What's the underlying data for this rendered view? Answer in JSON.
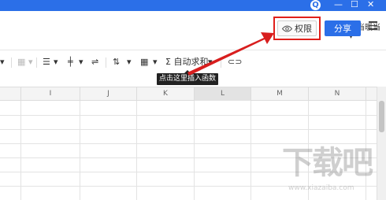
{
  "window": {
    "q_icon": "Q",
    "controls": [
      "—",
      "☐",
      "✕"
    ]
  },
  "header": {
    "username": "暖当暖当",
    "username_caret": "▾",
    "permission_label": "权限",
    "share_label": "分享"
  },
  "toolbar": {
    "autosum_label": "自动求和",
    "sum_symbol": "Σ",
    "tooltip": "点击这里插入函数"
  },
  "sheet": {
    "columns": [
      "",
      "I",
      "J",
      "K",
      "L",
      "M",
      "N"
    ],
    "selected_column": "L"
  },
  "watermark": {
    "text": "下载吧",
    "url": "www.xiazaiba.com"
  },
  "colors": {
    "accent": "#2b6fe8",
    "highlight": "#e0201b"
  }
}
